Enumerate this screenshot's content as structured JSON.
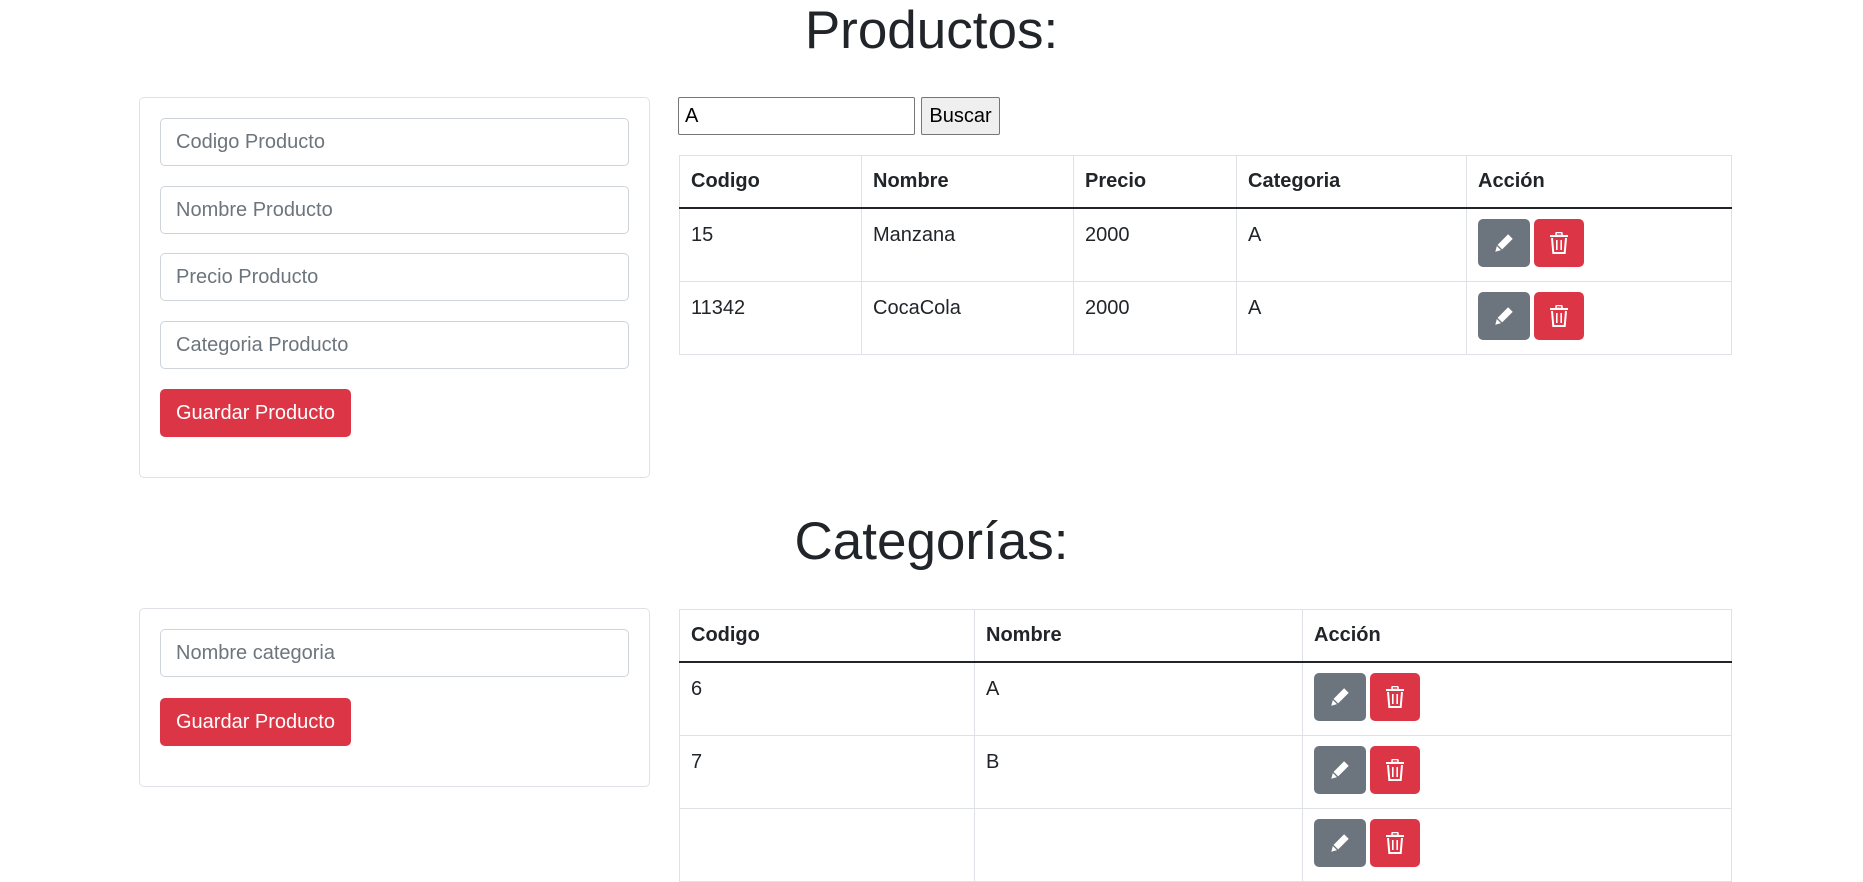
{
  "products_section": {
    "title": "Productos:",
    "form": {
      "code_placeholder": "Codigo Producto",
      "name_placeholder": "Nombre Producto",
      "price_placeholder": "Precio Producto",
      "category_placeholder": "Categoria Producto",
      "save_label": "Guardar Producto"
    },
    "search": {
      "value": "A",
      "button_label": "Buscar"
    },
    "table": {
      "headers": [
        "Codigo",
        "Nombre",
        "Precio",
        "Categoria",
        "Acción"
      ],
      "rows": [
        [
          "15",
          "Manzana",
          "2000",
          "A"
        ],
        [
          "11342",
          "CocaCola",
          "2000",
          "A"
        ]
      ]
    }
  },
  "categories_section": {
    "title": "Categorías:",
    "form": {
      "name_placeholder": "Nombre categoria",
      "save_label": "Guardar Producto"
    },
    "table": {
      "headers": [
        "Codigo",
        "Nombre",
        "Acción"
      ],
      "rows": [
        [
          "6",
          "A"
        ],
        [
          "7",
          "B"
        ],
        [
          "",
          ""
        ]
      ]
    }
  },
  "icons": {
    "edit": "pencil-icon",
    "delete": "trash-icon"
  },
  "colors": {
    "danger": "#dc3545",
    "secondary": "#6c757d",
    "text": "#212529"
  }
}
